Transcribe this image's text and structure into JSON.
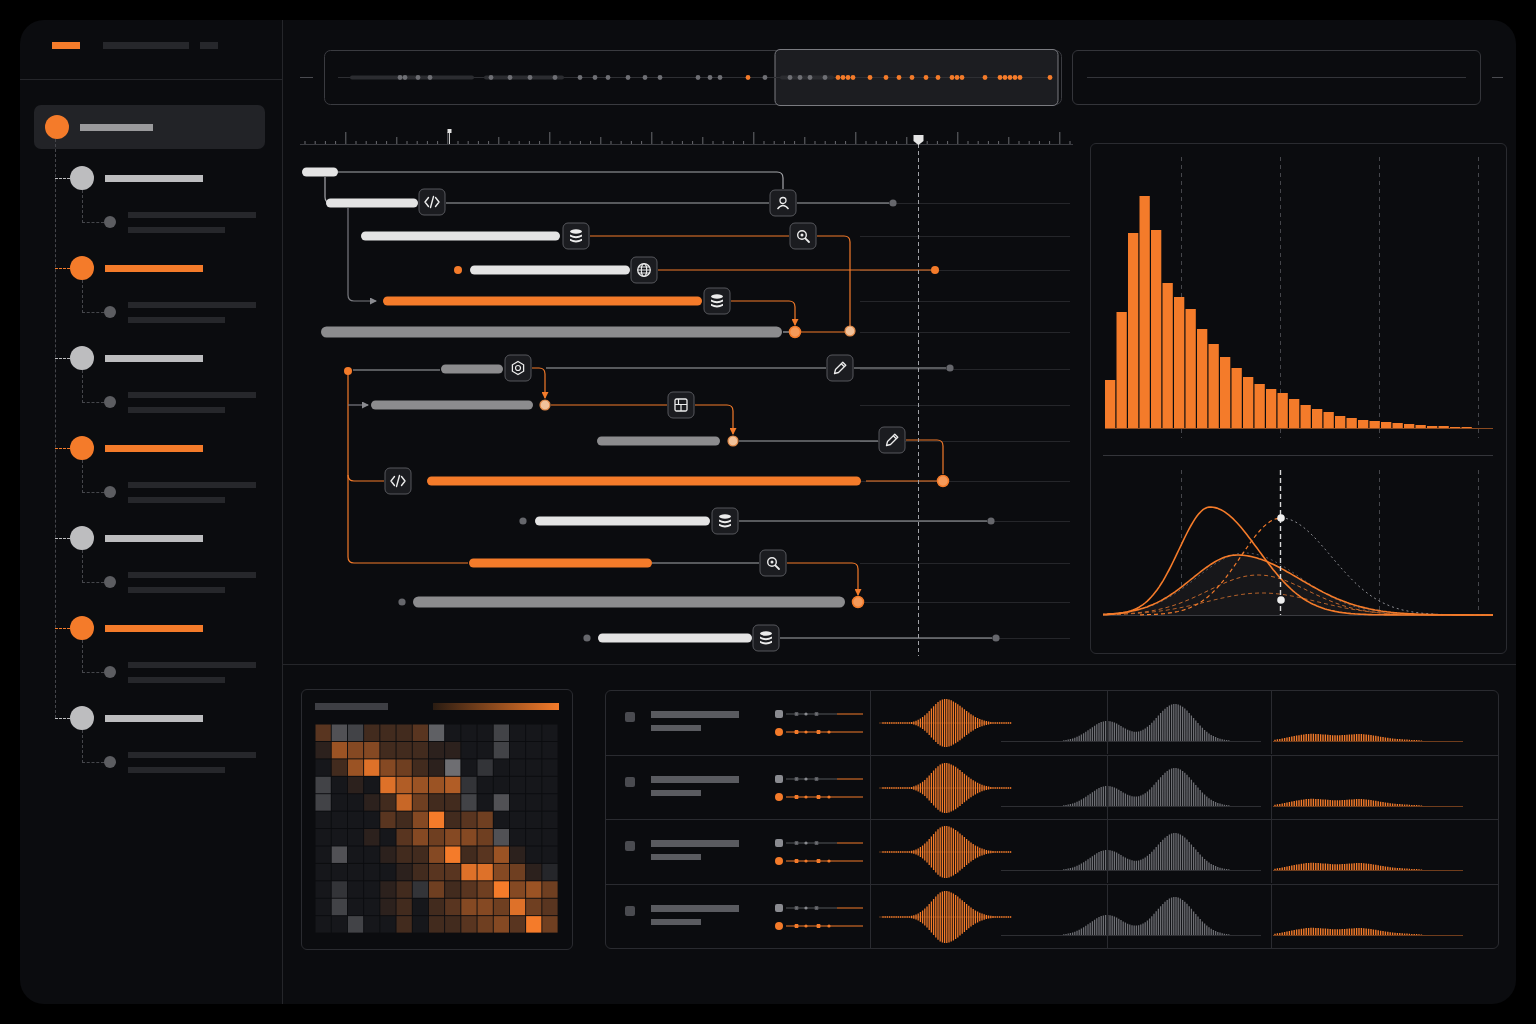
{
  "sidebar": {
    "tabs": [
      {
        "selected": true
      },
      {
        "selected": false
      },
      {
        "selected": false
      }
    ],
    "tree": [
      {
        "selected": true,
        "color": "#f47b2a",
        "children": [
          {
            "selected": false,
            "color": "#bdbdbf",
            "children": [
              {
                "selected": false
              }
            ]
          },
          {
            "selected": false,
            "color": "#f47b2a",
            "children": [
              {
                "selected": false
              }
            ]
          },
          {
            "selected": false,
            "color": "#bdbdbf",
            "children": [
              {
                "selected": false
              }
            ]
          },
          {
            "selected": false,
            "color": "#f47b2a",
            "children": [
              {
                "selected": false
              }
            ]
          },
          {
            "selected": false,
            "color": "#bdbdbf",
            "children": [
              {
                "selected": false
              }
            ]
          },
          {
            "selected": false,
            "color": "#f47b2a",
            "children": [
              {
                "selected": false
              }
            ]
          },
          {
            "selected": false,
            "color": "#bdbdbf",
            "children": [
              {
                "selected": false
              }
            ]
          }
        ]
      }
    ]
  },
  "timeline": {
    "tasks": [
      {
        "color": "#e4e4e4"
      },
      {
        "color": "#e4e4e4"
      },
      {
        "color": "#e4e4e4"
      },
      {
        "color": "#e4e4e4"
      },
      {
        "color": "#f47b2a"
      },
      {
        "color": "#8c8c8e"
      },
      {
        "color": "#8c8c8e"
      },
      {
        "color": "#8c8c8e"
      },
      {
        "color": "#8c8c8e"
      },
      {
        "color": "#f47b2a"
      },
      {
        "color": "#e4e4e4"
      },
      {
        "color": "#f47b2a"
      },
      {
        "color": "#8c8c8e"
      },
      {
        "color": "#e4e4e4"
      }
    ]
  },
  "table": {
    "rows": [
      {
        "checked": false
      },
      {
        "checked": false
      },
      {
        "checked": false
      },
      {
        "checked": false
      }
    ]
  }
}
